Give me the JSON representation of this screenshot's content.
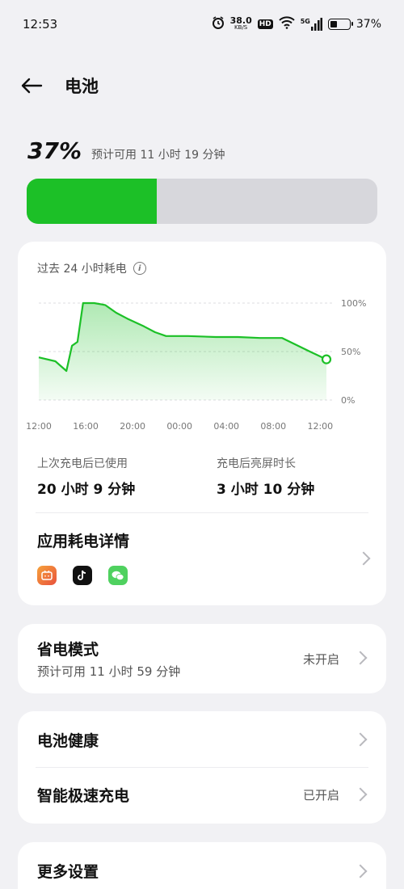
{
  "status_bar": {
    "time": "12:53",
    "speed_value": "38.0",
    "speed_unit": "KB/S",
    "hd": "HD",
    "network": "5G",
    "battery_text": "37%"
  },
  "header": {
    "title": "电池"
  },
  "summary": {
    "percent": "37%",
    "estimate": "预计可用 11 小时 19 分钟",
    "level": 0.37
  },
  "chart_card": {
    "title": "过去 24 小时耗电",
    "last_charge_label": "上次充电后已使用",
    "last_charge_value": "20 小时 9 分钟",
    "screen_time_label": "充电后亮屏时长",
    "screen_time_value": "3 小时 10 分钟",
    "app_detail_title": "应用耗电详情",
    "app_icons": [
      "bilibili-icon",
      "tiktok-icon",
      "wechat-icon"
    ]
  },
  "chart_data": {
    "type": "area",
    "x_tick_labels": [
      "12:00",
      "16:00",
      "20:00",
      "00:00",
      "04:00",
      "08:00",
      "12:00"
    ],
    "y_tick_labels": [
      "100%",
      "50%",
      "0%"
    ],
    "ylim": [
      0,
      100
    ],
    "x_hours": [
      0,
      1.5,
      2.5,
      3.0,
      3.5,
      4.0,
      5.0,
      6.0,
      7.0,
      8.0,
      9.5,
      10.5,
      11.5,
      12.5,
      13.5,
      16,
      18,
      20,
      22,
      24.5,
      26
    ],
    "values": [
      44,
      40,
      30,
      56,
      60,
      100,
      100,
      98,
      90,
      84,
      76,
      70,
      66,
      66,
      66,
      65,
      65,
      64,
      64,
      50,
      42
    ],
    "color": "#1cc027"
  },
  "power_saving": {
    "title": "省电模式",
    "subtitle": "预计可用 11 小时 59 分钟",
    "value": "未开启"
  },
  "battery_health": {
    "title": "电池健康"
  },
  "fast_charge": {
    "title": "智能极速充电",
    "value": "已开启"
  },
  "more_settings": {
    "title": "更多设置"
  }
}
